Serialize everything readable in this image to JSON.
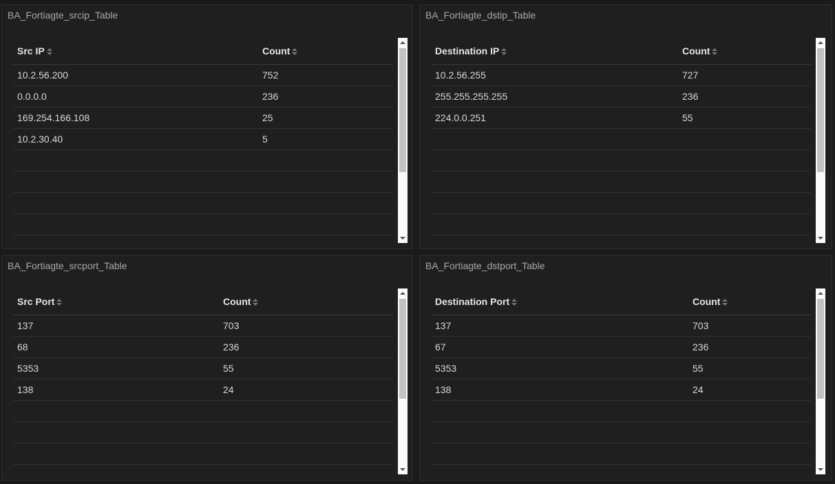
{
  "panels": [
    {
      "title": "BA_Fortiagte_srcip_Table",
      "columns": [
        "Src IP",
        "Count"
      ],
      "rows": [
        [
          "10.2.56.200",
          "752"
        ],
        [
          "0.0.0.0",
          "236"
        ],
        [
          "169.254.166.108",
          "25"
        ],
        [
          "10.2.30.40",
          "5"
        ],
        [
          "",
          ""
        ],
        [
          "",
          ""
        ],
        [
          "",
          ""
        ],
        [
          "",
          ""
        ]
      ]
    },
    {
      "title": "BA_Fortiagte_dstip_Table",
      "columns": [
        "Destination IP",
        "Count"
      ],
      "rows": [
        [
          "10.2.56.255",
          "727"
        ],
        [
          "255.255.255.255",
          "236"
        ],
        [
          "224.0.0.251",
          "55"
        ],
        [
          "",
          ""
        ],
        [
          "",
          ""
        ],
        [
          "",
          ""
        ],
        [
          "",
          ""
        ],
        [
          "",
          ""
        ]
      ]
    },
    {
      "title": "BA_Fortiagte_srcport_Table",
      "columns": [
        "Src Port",
        "Count"
      ],
      "rows": [
        [
          "137",
          "703"
        ],
        [
          "68",
          "236"
        ],
        [
          "5353",
          "55"
        ],
        [
          "138",
          "24"
        ],
        [
          "",
          ""
        ],
        [
          "",
          ""
        ],
        [
          "",
          ""
        ],
        [
          "",
          ""
        ]
      ]
    },
    {
      "title": "BA_Fortiagte_dstport_Table",
      "columns": [
        "Destination Port",
        "Count"
      ],
      "rows": [
        [
          "137",
          "703"
        ],
        [
          "67",
          "236"
        ],
        [
          "5353",
          "55"
        ],
        [
          "138",
          "24"
        ],
        [
          "",
          ""
        ],
        [
          "",
          ""
        ],
        [
          "",
          ""
        ],
        [
          "",
          ""
        ]
      ]
    }
  ],
  "icons": {
    "sort": "sort-icon",
    "scroll_up": "chevron-up-icon",
    "scroll_down": "chevron-down-icon"
  }
}
